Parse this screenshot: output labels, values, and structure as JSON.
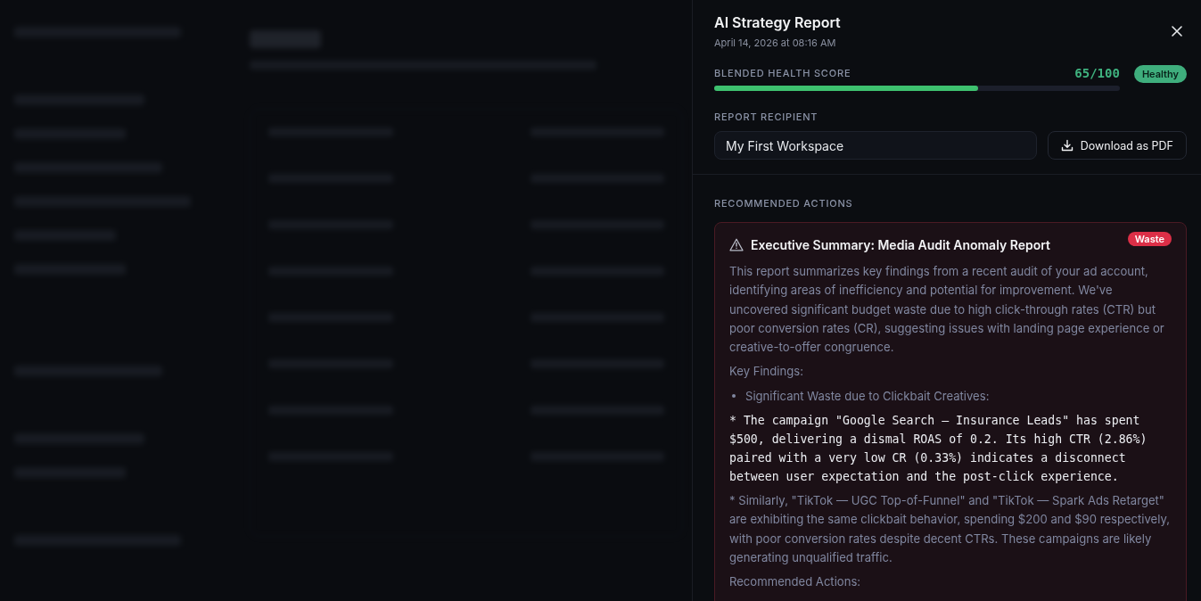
{
  "report": {
    "title": "AI Strategy Report",
    "date": "April 14, 2026 at 08:16 AM"
  },
  "health": {
    "label": "BLENDED HEALTH SCORE",
    "score": "65/100",
    "level": 0.65,
    "status": "Healthy",
    "kind": "healthy"
  },
  "recipient": {
    "label": "REPORT RECIPIENT",
    "value": "My First Workspace",
    "button": "Download as PDF"
  },
  "actions": {
    "label": "RECOMMENDED ACTIONS",
    "cards": [
      {
        "title": "Executive Summary: Media Audit Anomaly Report",
        "tag": "Waste",
        "kind": "waste",
        "blocks": [
          {
            "kind": "text",
            "text": "This report summarizes key findings from a recent audit of your ad account, identifying areas of inefficiency and potential for improvement. We've uncovered significant budget waste due to high click-through rates (CTR) but poor conversion rates (CR), suggesting issues with landing page experience or creative-to-offer congruence."
          },
          {
            "kind": "text",
            "text": "Key Findings:"
          },
          {
            "kind": "bullet",
            "text": "Significant Waste due to Clickbait Creatives:"
          },
          {
            "kind": "code",
            "text": "* The campaign \"Google Search — Insurance Leads\" has spent $500, delivering a dismal ROAS of 0.2. Its high CTR (2.86%) paired with a very low CR (0.33%) indicates a disconnect between user expectation and the post-click experience."
          },
          {
            "kind": "text",
            "text": "* Similarly, \"TikTok — UGC Top-of-Funnel\" and \"TikTok — Spark Ads Retarget\" are exhibiting the same clickbait behavior, spending $200 and $90 respectively, with poor conversion rates despite decent CTRs. These campaigns are likely generating unqualified traffic."
          },
          {
            "kind": "text",
            "text": "Recommended Actions:"
          }
        ]
      }
    ]
  }
}
